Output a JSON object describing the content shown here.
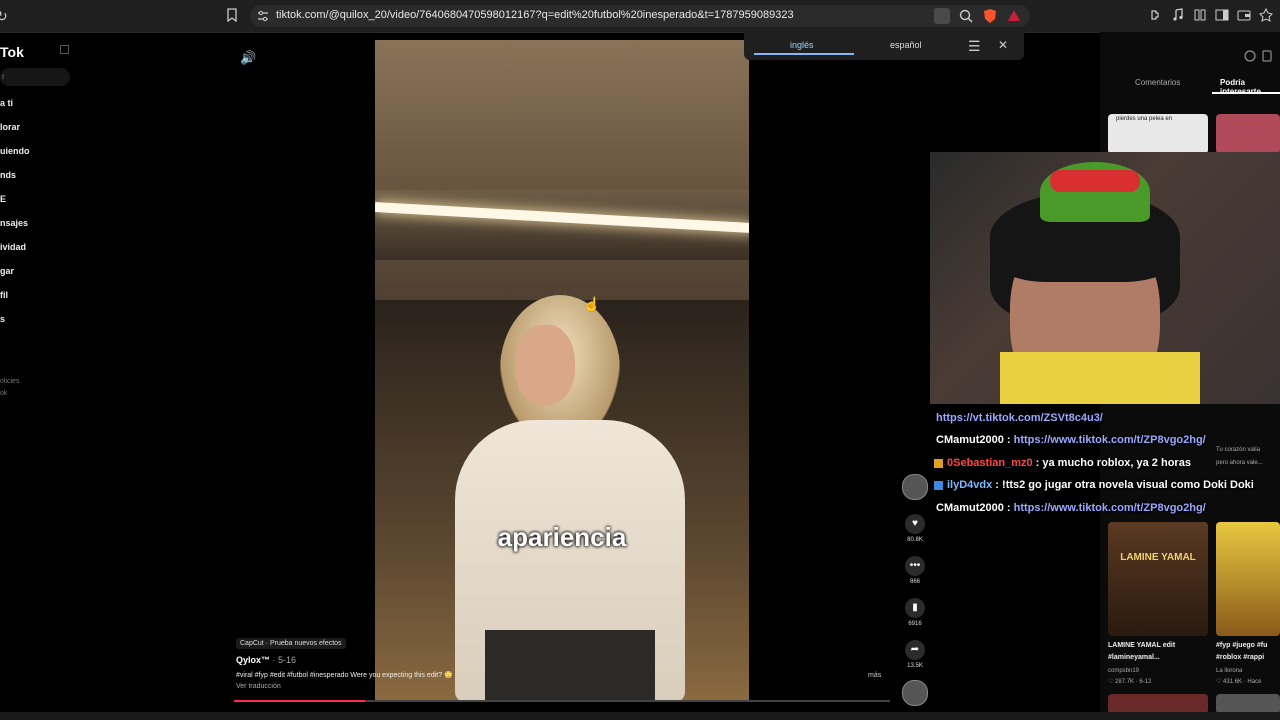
{
  "browser": {
    "url": "tiktok.com/@quilox_20/video/7640680470598012167?q=edit%20futbol%20inesperado&t=1787959089323"
  },
  "sidebar": {
    "logo": "Tok",
    "search_placeholder": "r",
    "items": [
      "a ti",
      "lorar",
      "uiendo",
      "nds",
      "E",
      "nsajes",
      "ividad",
      "gar",
      "fil",
      "s"
    ],
    "footer": [
      "olicies",
      "ok"
    ]
  },
  "translate_bar": {
    "lang_from": "inglés",
    "lang_to": "español"
  },
  "video": {
    "caption": "apariencia",
    "capcut_label": "CapCut · Prueba nuevos efectos",
    "author": "Qylox™",
    "date": "· 5-16",
    "description": "#viral #fyp #edit #futbol #inesperado Were you expecting this edit? 😳",
    "translate_link": "Ver traducción",
    "more": "más",
    "progress": 0.2
  },
  "actions": {
    "likes": "80.8K",
    "comments": "866",
    "saves": "6916",
    "shares": "13.5K"
  },
  "right_panel": {
    "tabs": [
      "Comentarios",
      "Podría interesarte"
    ],
    "top_thumb_text": "pierdes una pelea en",
    "videos": [
      {
        "title": "LAMINE YAMAL edit",
        "tags": "#lamineyamal...",
        "author": "compsbn19",
        "stats": "♡ 287.7K · 6-12",
        "thumb_text": "LAMINE YAMAL"
      },
      {
        "title": "#fyp #juego #fu",
        "tags": "#roblox #rappi",
        "author": "La llorona",
        "stats": "♡ 431.6K · Hace",
        "thumb_text": ""
      }
    ],
    "side_text_1": "Tu corazón valía",
    "side_text_2": "pero ahora vale..."
  },
  "stream_chat": {
    "messages": [
      {
        "user": "",
        "text": "https://vt.tiktok.com/ZSVt8c4u3/",
        "type": "link"
      },
      {
        "user": "CMamut2000",
        "text": "https://www.tiktok.com/t/ZP8vgo2hg/",
        "type": "user-link"
      },
      {
        "user": "0Sebastian_mz0",
        "text": "ya mucho roblox, ya 2 horas",
        "type": "user-red"
      },
      {
        "user": "ilyD4vdx",
        "text": "!tts2 go jugar otra novela visual como Doki Doki",
        "type": "user-cyan"
      },
      {
        "user": "CMamut2000",
        "text": "https://www.tiktok.com/t/ZP8vgo2hg/",
        "type": "user-link"
      }
    ]
  },
  "colors": {
    "accent": "#fe2c55",
    "link": "#9ba8ff",
    "chat_red": "#ff4646",
    "chat_cyan": "#7fb8ff"
  }
}
